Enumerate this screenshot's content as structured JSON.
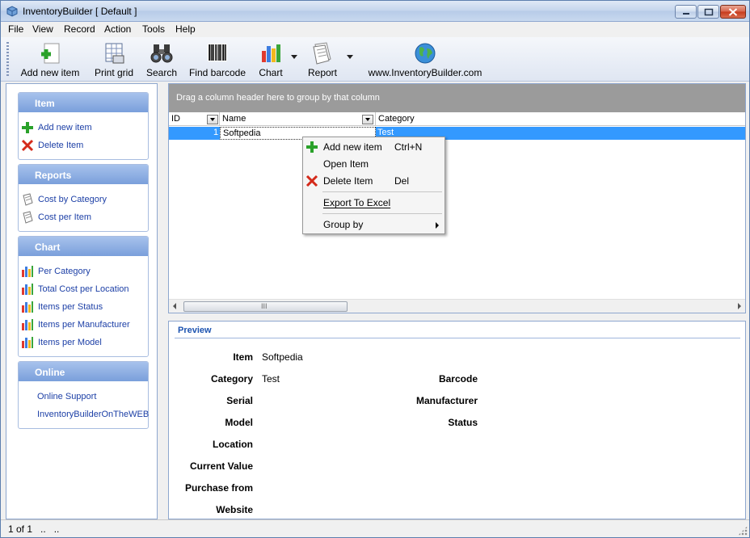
{
  "window": {
    "title": "InventoryBuilder [ Default ]"
  },
  "menu": [
    "File",
    "View",
    "Record",
    "Action",
    "Tools",
    "Help"
  ],
  "toolbar": {
    "add": "Add new item",
    "print": "Print grid",
    "search": "Search",
    "barcode": "Find barcode",
    "chart": "Chart",
    "report": "Report",
    "web": "www.InventoryBuilder.com"
  },
  "sidebar": {
    "item": {
      "title": "Item",
      "links": [
        "Add new item",
        "Delete Item"
      ]
    },
    "reports": {
      "title": "Reports",
      "links": [
        "Cost by Category",
        "Cost per Item"
      ]
    },
    "chart": {
      "title": "Chart",
      "links": [
        "Per Category",
        "Total Cost per Location",
        "Items per Status",
        "Items per Manufacturer",
        "Items per Model"
      ]
    },
    "online": {
      "title": "Online",
      "links": [
        "Online Support",
        "InventoryBuilderOnTheWEB"
      ]
    }
  },
  "grid": {
    "group_hint": "Drag a column header here to group by that column",
    "columns": [
      "ID",
      "Name",
      "Category"
    ],
    "rows": [
      {
        "id": "1",
        "name": "Softpedia",
        "category": "Test"
      }
    ],
    "hscroll_grip": "III"
  },
  "context_menu": {
    "items": [
      {
        "label": "Add new item",
        "shortcut": "Ctrl+N"
      },
      {
        "label": "Open Item",
        "shortcut": ""
      },
      {
        "label": "Delete Item",
        "shortcut": "Del"
      },
      {
        "label": "Export To Excel",
        "shortcut": ""
      },
      {
        "label": "Group by",
        "shortcut": ""
      }
    ]
  },
  "preview": {
    "title": "Preview",
    "fields_left": [
      {
        "label": "Item",
        "value": "Softpedia"
      },
      {
        "label": "Category",
        "value": "Test"
      },
      {
        "label": "Serial",
        "value": ""
      },
      {
        "label": "Model",
        "value": ""
      },
      {
        "label": "Location",
        "value": ""
      },
      {
        "label": "Current Value",
        "value": ""
      },
      {
        "label": "Purchase from",
        "value": ""
      },
      {
        "label": "Website",
        "value": ""
      }
    ],
    "fields_right": [
      {
        "label": "Barcode",
        "value": ""
      },
      {
        "label": "Manufacturer",
        "value": ""
      },
      {
        "label": "Status",
        "value": ""
      }
    ]
  },
  "status": {
    "text": "1 of 1   ..   .."
  },
  "colors": {
    "selection": "#3399ff",
    "panel_header": "#7a9fdb",
    "link": "#1c3fa6",
    "preview_title": "#1c53b0"
  }
}
